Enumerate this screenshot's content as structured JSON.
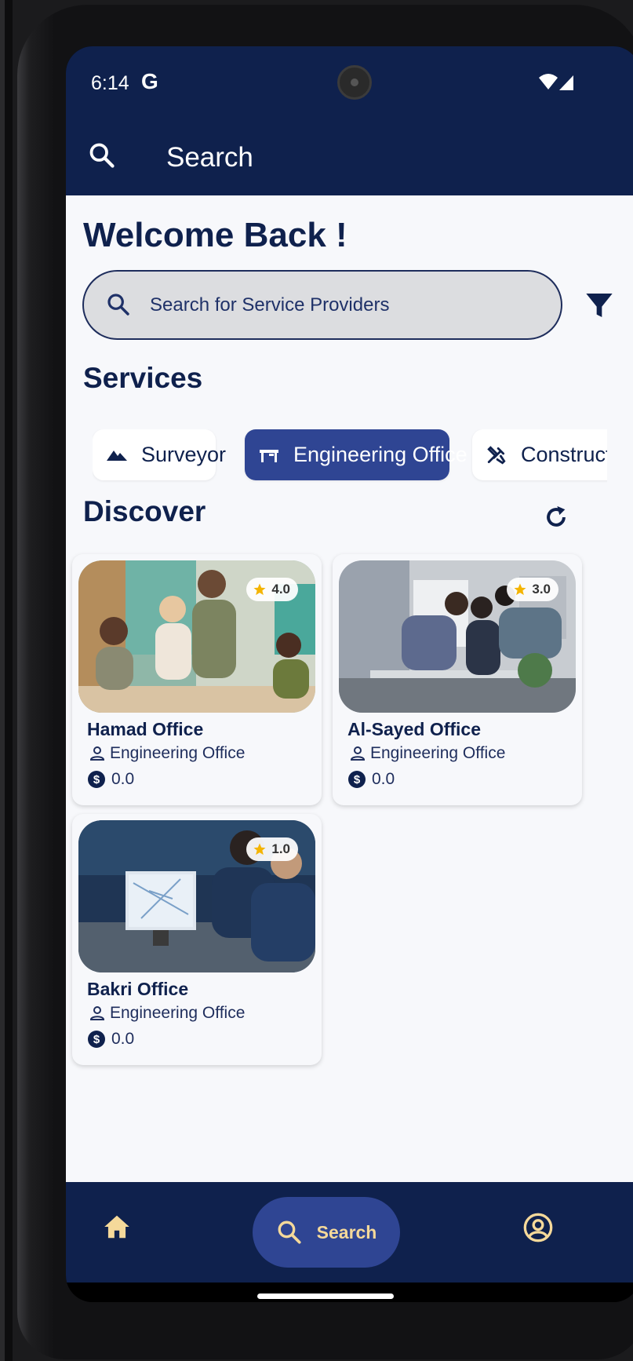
{
  "status_bar": {
    "time": "6:14",
    "g_label": "G"
  },
  "app_bar": {
    "title": "Search"
  },
  "welcome": "Welcome Back !",
  "search": {
    "placeholder": "Search for Service Providers"
  },
  "services": {
    "title": "Services",
    "chips": [
      {
        "label": "Surveyor",
        "icon": "terrain-icon",
        "selected": false
      },
      {
        "label": "Engineering Office",
        "icon": "office-desk-icon",
        "selected": true
      },
      {
        "label": "Construction",
        "icon": "tools-icon",
        "selected": false
      }
    ]
  },
  "discover": {
    "title": "Discover",
    "cards": [
      {
        "name": "Hamad Office",
        "type": "Engineering Office",
        "price": "0.0",
        "rating": "4.0"
      },
      {
        "name": "Al-Sayed Office",
        "type": "Engineering Office",
        "price": "0.0",
        "rating": "3.0"
      },
      {
        "name": "Bakri Office",
        "type": "Engineering Office",
        "price": "0.0",
        "rating": "1.0"
      }
    ]
  },
  "bottom_nav": {
    "search_label": "Search"
  },
  "colors": {
    "primary": "#0f214d",
    "accent": "#2f4593",
    "nav_gold": "#f5d99a",
    "star": "#f4b400"
  }
}
